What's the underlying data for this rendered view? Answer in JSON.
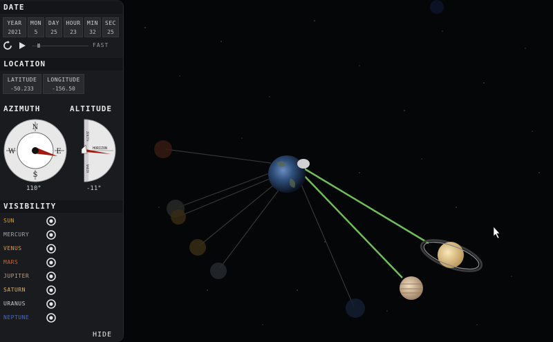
{
  "date": {
    "title": "DATE",
    "fields": [
      {
        "label": "YEAR",
        "value": "2021"
      },
      {
        "label": "MON",
        "value": "5"
      },
      {
        "label": "DAY",
        "value": "25"
      },
      {
        "label": "HOUR",
        "value": "23"
      },
      {
        "label": "MIN",
        "value": "32"
      },
      {
        "label": "SEC",
        "value": "25"
      }
    ],
    "speed_label": "FAST",
    "speed_level": 0.12
  },
  "location": {
    "title": "LOCATION",
    "latitude_label": "LATITUDE",
    "latitude": "-50.233",
    "longitude_label": "LONGITUDE",
    "longitude": "-156.50"
  },
  "azimuth": {
    "title": "AZIMUTH",
    "value": "110°",
    "compass": {
      "n": "N",
      "e": "E",
      "s": "S",
      "w": "W"
    }
  },
  "altitude": {
    "title": "ALTITUDE",
    "value": "-11°",
    "labels": {
      "zenith": "ZENITH",
      "horizon": "HORIZON",
      "nadir": "NADIR"
    }
  },
  "visibility": {
    "title": "VISIBILITY",
    "items": [
      {
        "name": "SUN",
        "color": "#d8a31e"
      },
      {
        "name": "MERCURY",
        "color": "#a8a8a8"
      },
      {
        "name": "VENUS",
        "color": "#d99a4a"
      },
      {
        "name": "MARS",
        "color": "#c8643a"
      },
      {
        "name": "JUPITER",
        "color": "#b8a08a"
      },
      {
        "name": "SATURN",
        "color": "#d9b46a"
      },
      {
        "name": "URANUS",
        "color": "#c8ccd0"
      },
      {
        "name": "NEPTUNE",
        "color": "#4a6cc8"
      }
    ]
  },
  "hide_label": "HIDE"
}
